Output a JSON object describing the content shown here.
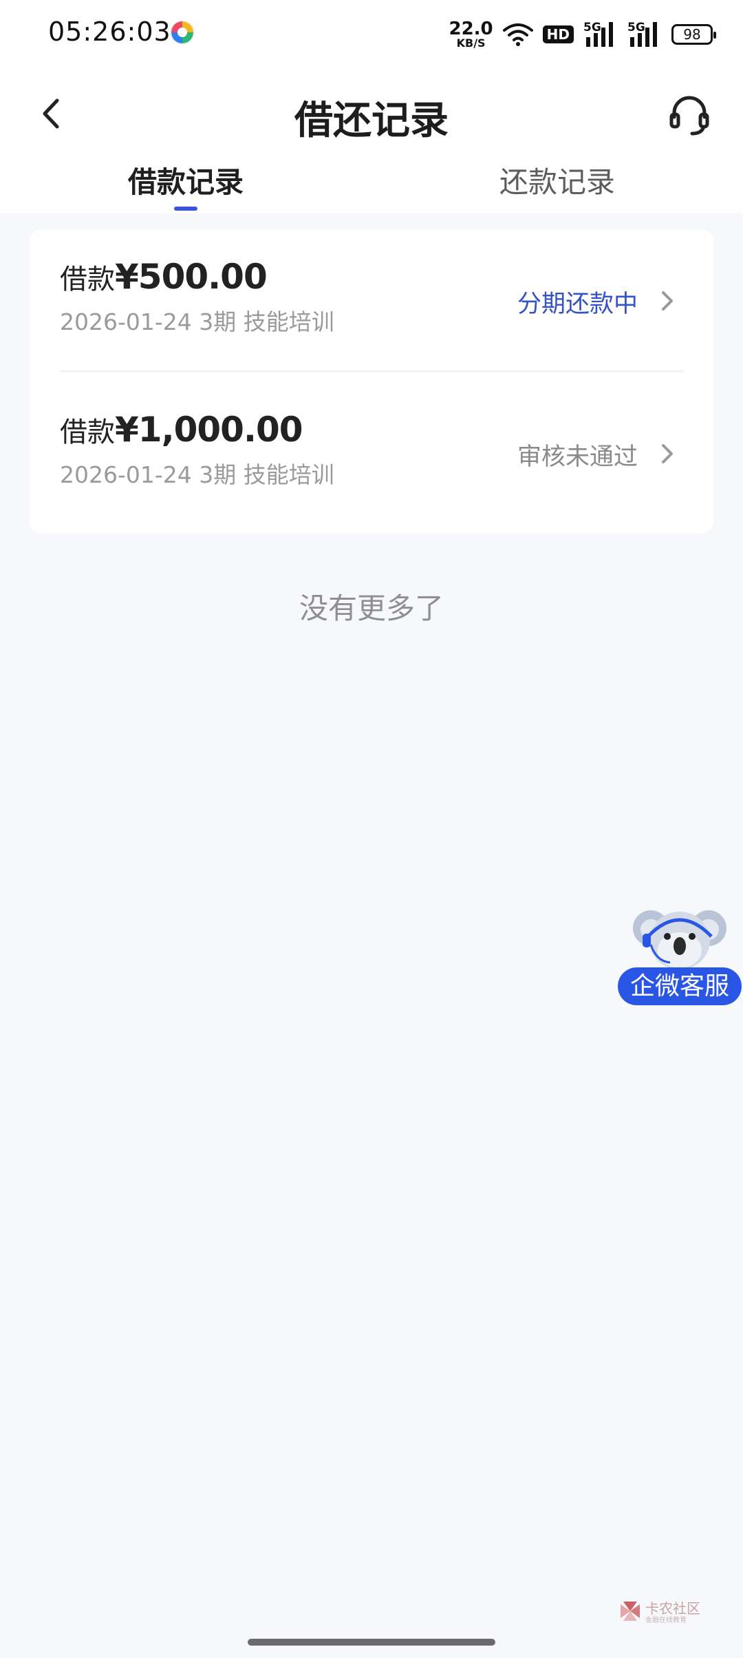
{
  "status_bar": {
    "time": "05:26:03",
    "net_speed_value": "22.0",
    "net_speed_unit": "KB/S",
    "hd_label": "HD",
    "signal1_label": "5G",
    "signal2_label": "5G",
    "battery": "98"
  },
  "navbar": {
    "title": "借还记录",
    "back_icon": "chevron-left-icon",
    "service_icon": "headset-icon"
  },
  "tabs": [
    {
      "label": "借款记录",
      "active": true
    },
    {
      "label": "还款记录",
      "active": false
    }
  ],
  "records": [
    {
      "label": "借款",
      "amount": "¥500.00",
      "meta": "2026-01-24 3期  技能培训",
      "status": "分期还款中"
    },
    {
      "label": "借款",
      "amount": "¥1,000.00",
      "meta": "2026-01-24 3期  技能培训",
      "status": "审核未通过"
    }
  ],
  "no_more_text": "没有更多了",
  "float_service": {
    "label": "企微客服",
    "icon": "koala-mascot-icon"
  },
  "watermark": {
    "title": "卡农社区",
    "subtitle": "金融在线教育"
  },
  "colors": {
    "accent": "#3a55d8",
    "status_active": "#3553c9",
    "status_rejected": "#8a8a8a",
    "float_button": "#2a56e6",
    "background": "#f7f8fc"
  }
}
